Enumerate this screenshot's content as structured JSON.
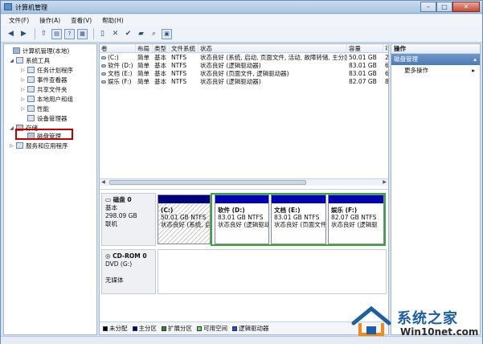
{
  "window": {
    "title": "计算机管理",
    "minimize": "–",
    "maximize": "□",
    "close": "✕"
  },
  "menu": [
    "文件(F)",
    "操作(A)",
    "查看(V)",
    "帮助(H)"
  ],
  "tree": [
    {
      "label": "计算机管理(本地)",
      "level": 0,
      "twisty": ""
    },
    {
      "label": "系统工具",
      "level": 1,
      "twisty": "◢"
    },
    {
      "label": "任务计划程序",
      "level": 2,
      "twisty": "▷"
    },
    {
      "label": "事件查看器",
      "level": 2,
      "twisty": "▷"
    },
    {
      "label": "共享文件夹",
      "level": 2,
      "twisty": "▷"
    },
    {
      "label": "本地用户和组",
      "level": 2,
      "twisty": "▷"
    },
    {
      "label": "性能",
      "level": 2,
      "twisty": "▷"
    },
    {
      "label": "设备管理器",
      "level": 2,
      "twisty": ""
    },
    {
      "label": "存储",
      "level": 1,
      "twisty": "◢"
    },
    {
      "label": "磁盘管理",
      "level": 2,
      "twisty": ""
    },
    {
      "label": "服务和应用程序",
      "level": 1,
      "twisty": "▷"
    }
  ],
  "volume_table": {
    "headers": [
      "卷",
      "布局",
      "类型",
      "文件系统",
      "状态",
      "容量",
      "可"
    ],
    "rows": [
      [
        "(C:)",
        "简单",
        "基本",
        "NTFS",
        "状态良好 (系统, 启动, 页面文件, 活动, 故障转储, 主分区)",
        "50.01 GB",
        "2"
      ],
      [
        "软件 (D:)",
        "简单",
        "基本",
        "NTFS",
        "状态良好 (逻辑驱动器)",
        "83.01 GB",
        "6"
      ],
      [
        "文档 (E:)",
        "简单",
        "基本",
        "NTFS",
        "状态良好 (页面文件, 逻辑驱动器)",
        "83.01 GB",
        "6"
      ],
      [
        "娱乐 (F:)",
        "简单",
        "基本",
        "NTFS",
        "状态良好 (逻辑驱动器)",
        "82.07 GB",
        "8"
      ]
    ]
  },
  "disk0": {
    "name": "磁盘 0",
    "type": "基本",
    "size": "298.09 GB",
    "status": "联机",
    "partitions": [
      {
        "name": "(C:)",
        "size": "50.01 GB NTFS",
        "status": "状态良好 (系统, 启",
        "style": "primary"
      },
      {
        "name": "软件 (D:)",
        "size": "83.01 GB NTFS",
        "status": "状态良好 (逻辑驱动器",
        "style": "logical"
      },
      {
        "name": "文档 (E:)",
        "size": "83.01 GB NTFS",
        "status": "状态良好 (页面文件",
        "style": "logical"
      },
      {
        "name": "娱乐 (F:)",
        "size": "82.07 GB NTFS",
        "status": "状态良好 (逻辑驱",
        "style": "logical"
      }
    ]
  },
  "cdrom": {
    "name": "CD-ROM 0",
    "drive": "DVD (G:)",
    "status": "无媒体"
  },
  "legend": [
    {
      "label": "未分配",
      "color": "#000000"
    },
    {
      "label": "主分区",
      "color": "#00007f"
    },
    {
      "label": "扩展分区",
      "color": "#2e8b2e"
    },
    {
      "label": "可用空间",
      "color": "#6dd96d"
    },
    {
      "label": "逻辑驱动器",
      "color": "#1f4fe0"
    }
  ],
  "actions": {
    "header": "操作",
    "section": "磁盘管理",
    "item": "更多操作"
  },
  "watermark": {
    "brand": "系统之家",
    "url": "Win10net.com"
  }
}
